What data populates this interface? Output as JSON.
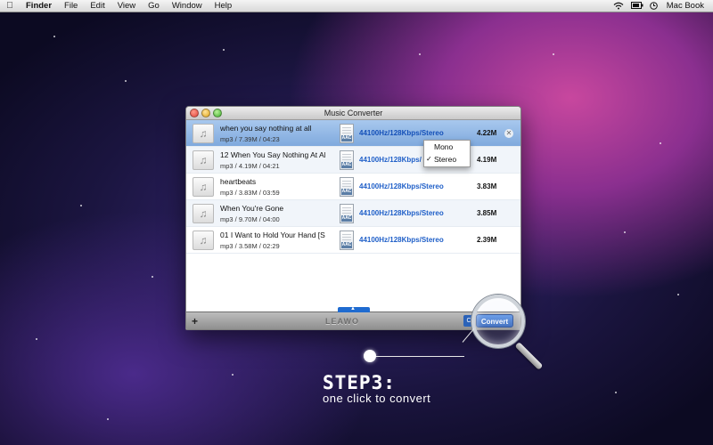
{
  "menubar": {
    "app": "Finder",
    "items": [
      "File",
      "Edit",
      "View",
      "Go",
      "Window",
      "Help"
    ],
    "user": "Mac Book"
  },
  "window": {
    "title": "Music Converter",
    "brand": "LEAWO",
    "convert_label": "Convert",
    "c_label": "C",
    "add_label": "+"
  },
  "files": [
    {
      "name": "when you say nothing at all",
      "meta": "mp3 / 7.39M / 04:23",
      "format_icon": "AAC",
      "format": "44100Hz/128Kbps/Stereo",
      "size": "4.22M"
    },
    {
      "name": "12 When You Say Nothing At Al",
      "meta": "mp3 / 4.19M / 04:21",
      "format_icon": "AAC",
      "format": "44100Hz/128Kbps/",
      "size": "4.19M"
    },
    {
      "name": "heartbeats",
      "meta": "mp3 / 3.83M / 03:59",
      "format_icon": "AAC",
      "format": "44100Hz/128Kbps/Stereo",
      "size": "3.83M"
    },
    {
      "name": "When You're Gone",
      "meta": "mp3 / 9.70M / 04:00",
      "format_icon": "AAC",
      "format": "44100Hz/128Kbps/Stereo",
      "size": "3.85M"
    },
    {
      "name": "01 I Want to Hold Your Hand [S",
      "meta": "mp3 / 3.58M / 02:29",
      "format_icon": "AAC",
      "format": "44100Hz/128Kbps/Stereo",
      "size": "2.39M"
    }
  ],
  "channel_menu": {
    "options": [
      "Mono",
      "Stereo"
    ],
    "selected": "Stereo"
  },
  "overlay": {
    "step": "STEP3:",
    "tagline": "one click to convert"
  },
  "colors": {
    "accent": "#2b5fb7",
    "format_text": "#1f5fc8",
    "selected_row": "#8fb5e4"
  }
}
